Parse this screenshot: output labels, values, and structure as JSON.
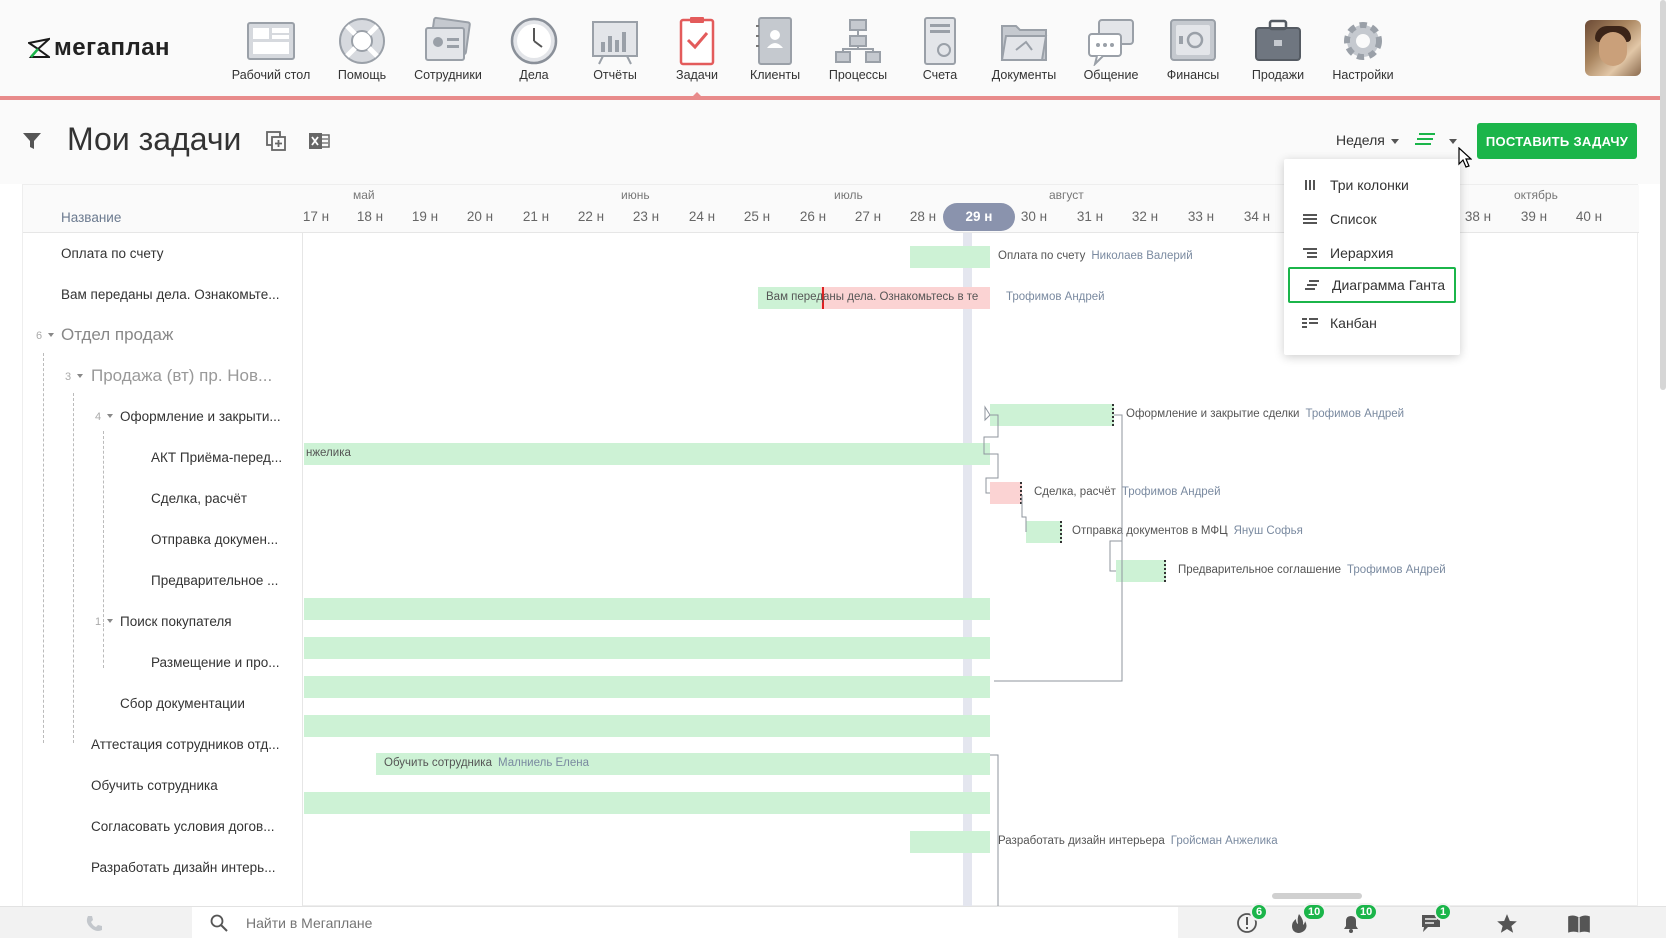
{
  "logo": {
    "text": "мегаплан"
  },
  "nav": [
    {
      "label": "Рабочий стол",
      "icon": "desktop-icon"
    },
    {
      "label": "Помощь",
      "icon": "lifebuoy-icon"
    },
    {
      "label": "Сотрудники",
      "icon": "employees-icon"
    },
    {
      "label": "Дела",
      "icon": "clock-icon"
    },
    {
      "label": "Отчёты",
      "icon": "reports-icon"
    },
    {
      "label": "Задачи",
      "icon": "tasks-icon",
      "active": true
    },
    {
      "label": "Клиенты",
      "icon": "clients-icon"
    },
    {
      "label": "Процессы",
      "icon": "processes-icon"
    },
    {
      "label": "Счета",
      "icon": "invoices-icon"
    },
    {
      "label": "Документы",
      "icon": "documents-icon"
    },
    {
      "label": "Общение",
      "icon": "chat-icon"
    },
    {
      "label": "Финансы",
      "icon": "safe-icon"
    },
    {
      "label": "Продажи",
      "icon": "briefcase-icon"
    },
    {
      "label": "Настройки",
      "icon": "gear-icon"
    }
  ],
  "header": {
    "title": "Мои задачи",
    "period": "Неделя",
    "create_button": "ПОСТАВИТЬ ЗАДАЧУ"
  },
  "gantt": {
    "name_column": "Название",
    "months": [
      "май",
      "июнь",
      "июль",
      "август",
      "октябрь"
    ],
    "weeks": [
      "17 н",
      "18 н",
      "19 н",
      "20 н",
      "21 н",
      "22 н",
      "23 н",
      "24 н",
      "25 н",
      "26 н",
      "27 н",
      "28 н",
      "29 н",
      "30 н",
      "31 н",
      "32 н",
      "33 н",
      "34 н",
      "38 н",
      "39 н",
      "40 н"
    ],
    "current_week": "29 н",
    "tasks": [
      {
        "name": "Оплата по счету"
      },
      {
        "name": "Вам переданы дела. Ознакомьте..."
      },
      {
        "name": "Отдел продаж",
        "count": "6"
      },
      {
        "name": "Продажа (вт) пр. Нов...",
        "count": "3"
      },
      {
        "name": "Оформление и закрыти...",
        "count": "4"
      },
      {
        "name": "АКТ Приёма-перед..."
      },
      {
        "name": "Сделка, расчёт"
      },
      {
        "name": "Отправка докумен..."
      },
      {
        "name": "Предварительное ..."
      },
      {
        "name": "Поиск покупателя",
        "count": "1"
      },
      {
        "name": "Размещение и про..."
      },
      {
        "name": "Сбор документации"
      },
      {
        "name": "Аттестация сотрудников отд..."
      },
      {
        "name": "Обучить сотрудника"
      },
      {
        "name": "Согласовать условия догов..."
      },
      {
        "name": "Разработать дизайн интерь..."
      }
    ],
    "bars": {
      "payment": {
        "title": "Оплата по счету",
        "assignee": "Николаев Валерий"
      },
      "handover": {
        "title": "Вам переданы дела. Ознакомьтесь в те",
        "assignee": "Трофимов Андрей"
      },
      "closing": {
        "title": "Оформление и закрытие сделки",
        "assignee": "Трофимов Андрей"
      },
      "act": {
        "title": "нжелика"
      },
      "deal": {
        "title": "Сделка, расчёт",
        "assignee": "Трофимов Андрей"
      },
      "sending": {
        "title": "Отправка документов в МФЦ",
        "assignee": "Януш Софья"
      },
      "preliminary": {
        "title": "Предварительное соглашение",
        "assignee": "Трофимов Андрей"
      },
      "training": {
        "title": "Обучить сотрудника",
        "assignee": "Малниель Елена"
      },
      "design": {
        "title": "Разработать дизайн интерьера",
        "assignee": "Гройсман Анжелика"
      }
    }
  },
  "view_menu": {
    "items": [
      {
        "label": "Три колонки",
        "icon": "three-columns-icon"
      },
      {
        "label": "Список",
        "icon": "list-icon"
      },
      {
        "label": "Иерархия",
        "icon": "hierarchy-icon"
      },
      {
        "label": "Диаграмма Ганта",
        "icon": "gantt-icon",
        "selected": true
      },
      {
        "label": "Канбан",
        "icon": "kanban-icon"
      }
    ]
  },
  "bottom": {
    "search_placeholder": "Найти в Мегаплане",
    "badges": {
      "alerts": "6",
      "hot": "10",
      "notifications": "10",
      "messages": "1"
    }
  },
  "colors": {
    "accent": "#1bb54a",
    "nav_underline": "#e88b8b",
    "bar_green": "#cdf2d5",
    "bar_red": "#fbd3d3",
    "current_week": "#8a93ad"
  }
}
